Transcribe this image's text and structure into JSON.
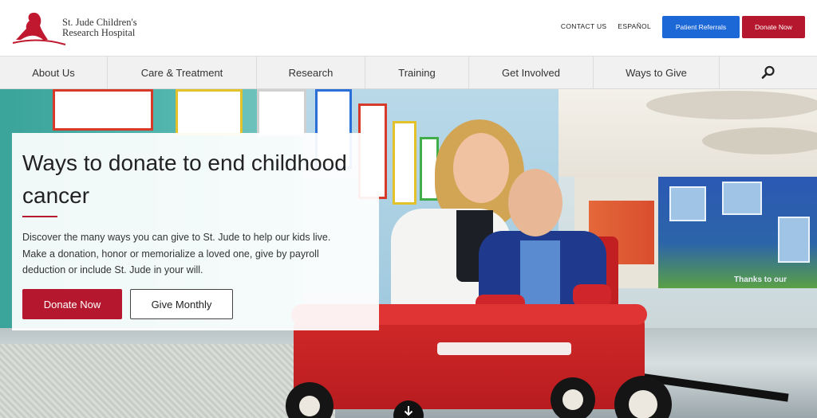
{
  "header": {
    "logo_line1": "St. Jude Children's",
    "logo_line2": "Research Hospital",
    "util_links": [
      "CONTACT US",
      "ESPAÑOL"
    ],
    "patient_referrals": "Patient Referrals",
    "donate_now": "Donate Now",
    "colors": {
      "blue": "#1c68d6",
      "red": "#b5182e"
    }
  },
  "nav": {
    "items": [
      "About Us",
      "Care & Treatment",
      "Research",
      "Training",
      "Get Involved",
      "Ways to Give"
    ],
    "search_icon": "search-icon"
  },
  "hero": {
    "title": "Ways to donate to end childhood cancer",
    "description": "Discover the many ways you can give to St. Jude to help our kids live. Make a donation, honor or memorialize a loved one, give by payroll deduction or include St. Jude in your will.",
    "primary_button": "Donate Now",
    "secondary_button": "Give Monthly",
    "display_wall_text": "Thanks to our",
    "scroll_icon": "arrow-down-icon"
  }
}
